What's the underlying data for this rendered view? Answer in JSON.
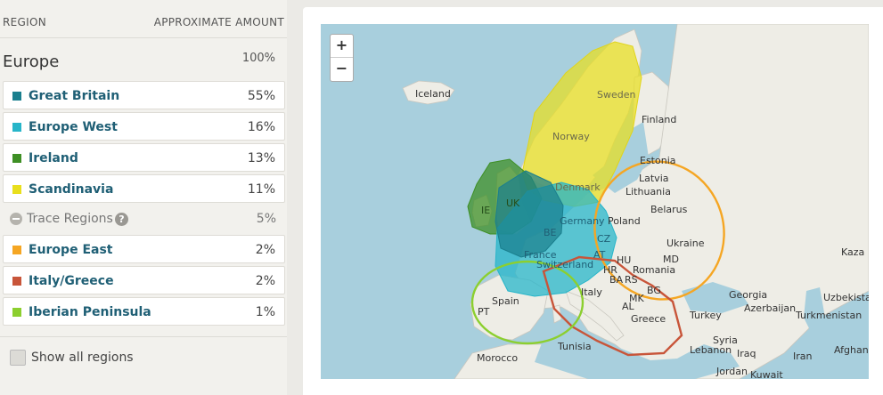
{
  "header": {
    "region": "REGION",
    "amount": "APPROXIMATE AMOUNT"
  },
  "europe": {
    "name": "Europe",
    "pct": "100%"
  },
  "regions": [
    {
      "label": "Great Britain",
      "pct": "55%",
      "color": "#1a7f8e"
    },
    {
      "label": "Europe West",
      "pct": "16%",
      "color": "#27b5c9"
    },
    {
      "label": "Ireland",
      "pct": "13%",
      "color": "#3e8f25"
    },
    {
      "label": "Scandinavia",
      "pct": "11%",
      "color": "#e9df1d"
    }
  ],
  "trace": {
    "label": "Trace Regions",
    "help": "?",
    "pct": "5%"
  },
  "trace_regions": [
    {
      "label": "Europe East",
      "pct": "2%",
      "color": "#f5a623"
    },
    {
      "label": "Italy/Greece",
      "pct": "2%",
      "color": "#c8553a"
    },
    {
      "label": "Iberian Peninsula",
      "pct": "1%",
      "color": "#8ccf2f"
    }
  ],
  "show_all": "Show all regions",
  "map": {
    "zoom_in": "+",
    "zoom_out": "−",
    "labels": {
      "iceland": "Iceland",
      "sweden": "Sweden",
      "finland": "Finland",
      "norway": "Norway",
      "estonia": "Estonia",
      "latvia": "Latvia",
      "lithuania": "Lithuania",
      "denmark": "Denmark",
      "belarus": "Belarus",
      "ie": "IE",
      "uk": "UK",
      "germany": "Germany",
      "poland": "Poland",
      "be": "BE",
      "cz": "CZ",
      "ukraine": "Ukraine",
      "kazakhstan": "Kaza",
      "france": "France",
      "at": "AT",
      "switzerland": "Switzerland",
      "hu": "HU",
      "md": "MD",
      "hr": "HR",
      "romania": "Romania",
      "ba": "BA",
      "rs": "RS",
      "italy": "Italy",
      "bg": "BG",
      "georgia": "Georgia",
      "uzbekistan": "Uzbekistan",
      "mk": "MK",
      "spain": "Spain",
      "al": "AL",
      "azerbaijan": "Azerbaijan",
      "pt": "PT",
      "turkmenistan": "Turkmenistan",
      "greece": "Greece",
      "turkey": "Turkey",
      "syria": "Syria",
      "tunisia": "Tunisia",
      "lebanon": "Lebanon",
      "iraq": "Iraq",
      "iran": "Iran",
      "afghanistan": "Afghani",
      "morocco": "Morocco",
      "jordan": "Jordan",
      "kuwait": "Kuwait"
    }
  }
}
